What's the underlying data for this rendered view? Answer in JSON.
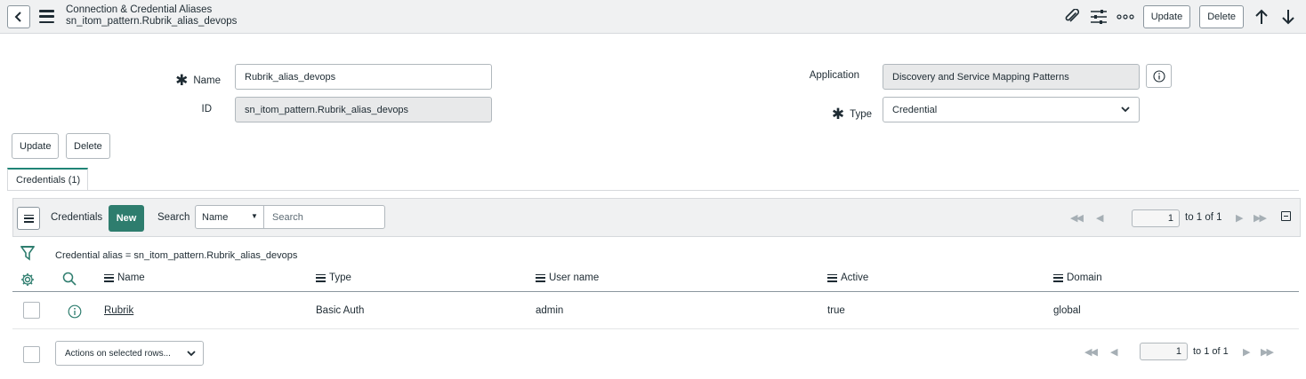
{
  "header": {
    "title": "Connection & Credential Aliases",
    "subtitle": "sn_itom_pattern.Rubrik_alias_devops",
    "update_label": "Update",
    "delete_label": "Delete"
  },
  "form": {
    "name_label": "Name",
    "name_value": "Rubrik_alias_devops",
    "id_label": "ID",
    "id_value": "sn_itom_pattern.Rubrik_alias_devops",
    "application_label": "Application",
    "application_value": "Discovery and Service Mapping Patterns",
    "type_label": "Type",
    "type_value": "Credential",
    "update_label": "Update",
    "delete_label": "Delete"
  },
  "tabs": [
    {
      "label": "Credentials (1)"
    }
  ],
  "list": {
    "title": "Credentials",
    "new_label": "New",
    "search_label": "Search",
    "search_field": "Name",
    "search_placeholder": "Search",
    "page_value": "1",
    "page_total": "to 1 of 1",
    "filter_text": "Credential alias = sn_itom_pattern.Rubrik_alias_devops",
    "columns": [
      "Name",
      "Type",
      "User name",
      "Active",
      "Domain"
    ],
    "rows": [
      {
        "name": "Rubrik",
        "type": "Basic Auth",
        "user_name": "admin",
        "active": "true",
        "domain": "global"
      }
    ],
    "actions_label": "Actions on selected rows..."
  },
  "colors": {
    "accent": "#2e7d6e",
    "tab_accent": "#1f8476",
    "header_bg": "#f0f1f2"
  },
  "icons": [
    "back-arrow-icon",
    "hamburger-icon",
    "paperclip-icon",
    "sliders-icon",
    "more-icon",
    "arrow-up-icon",
    "arrow-down-icon",
    "info-icon",
    "filter-icon",
    "gear-icon",
    "search-icon",
    "collapse-icon",
    "chevron-down-icon"
  ]
}
